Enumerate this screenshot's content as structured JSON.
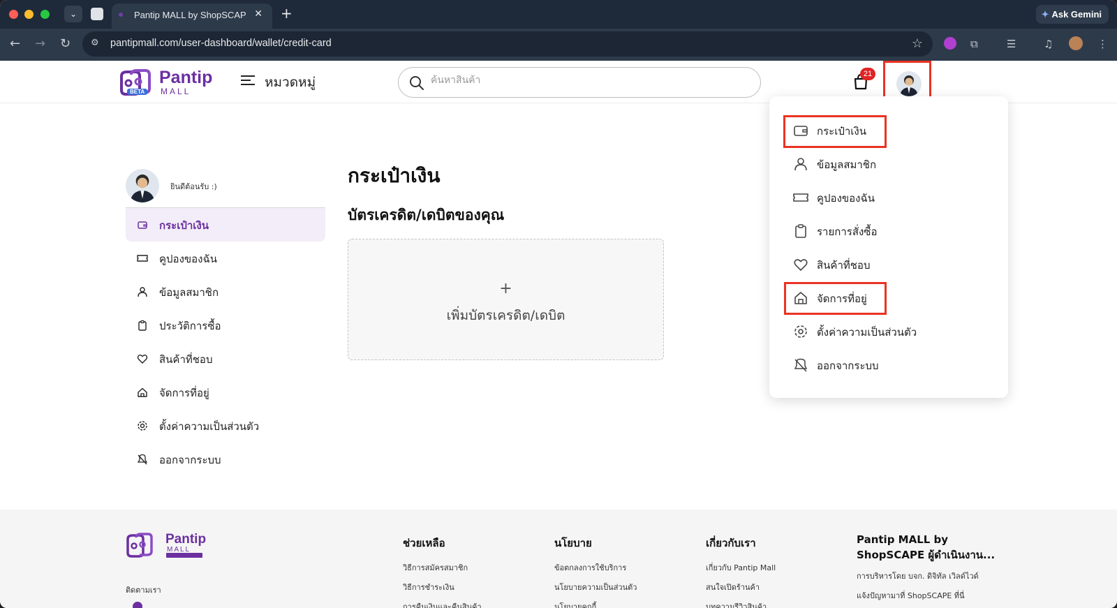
{
  "browser": {
    "tab_title": "Pantip MALL by ShopSCAPE",
    "new_tab": "+",
    "close": "✕",
    "ask_gemini": "Ask Gemini",
    "url": "pantipmall.com/user-dashboard/wallet/credit-card"
  },
  "header": {
    "logo_text": "Pantip",
    "logo_sub": "MALL",
    "beta": "BETA",
    "category_label": "หมวดหมู่",
    "search_placeholder": "ค้นหาสินค้า",
    "cart_count": "21"
  },
  "sidebar": {
    "welcome": "ยินดีต้อนรับ :)",
    "items": [
      {
        "label": "กระเป๋าเงิน"
      },
      {
        "label": "คูปองของฉัน"
      },
      {
        "label": "ข้อมูลสมาชิก"
      },
      {
        "label": "ประวัติการซื้อ"
      },
      {
        "label": "สินค้าที่ชอบ"
      },
      {
        "label": "จัดการที่อยู่"
      },
      {
        "label": "ตั้งค่าความเป็นส่วนตัว"
      },
      {
        "label": "ออกจากระบบ"
      }
    ]
  },
  "main": {
    "title": "กระเป๋าเงิน",
    "subtitle": "บัตรเครดิต/เดบิตของคุณ",
    "add_plus": "+",
    "add_card_label": "เพิ่มบัตรเครดิต/เดบิต"
  },
  "dropdown": {
    "items": [
      {
        "label": "กระเป๋าเงิน"
      },
      {
        "label": "ข้อมูลสมาชิก"
      },
      {
        "label": "คูปองของฉัน"
      },
      {
        "label": "รายการสั่งซื้อ"
      },
      {
        "label": "สินค้าที่ชอบ"
      },
      {
        "label": "จัดการที่อยู่"
      },
      {
        "label": "ตั้งค่าความเป็นส่วนตัว"
      },
      {
        "label": "ออกจากระบบ"
      }
    ]
  },
  "footer": {
    "follow_us": "ติดตามเรา",
    "help": {
      "title": "ช่วยเหลือ",
      "links": [
        "วิธีการสมัครสมาชิก",
        "วิธีการชำระเงิน",
        "การคืนเงินและคืนสินค้า"
      ]
    },
    "policy": {
      "title": "นโยบาย",
      "links": [
        "ข้อตกลงการใช้บริการ",
        "นโยบายความเป็นส่วนตัว",
        "นโยบายคุกกี้"
      ]
    },
    "about": {
      "title": "เกี่ยวกับเรา",
      "links": [
        "เกี่ยวกับ Pantip Mall",
        "สนใจเปิดร้านค้า",
        "บทความรีวิวสินค้า"
      ]
    },
    "operator": {
      "title": "Pantip MALL by ShopSCAPE ผู้ดำเนินงาน...",
      "links": [
        "การบริหารโดย บจก. ดิจิทัล เวิลด์ไวด์",
        "แจ้งปัญหามาที่ ShopSCAPE ที่นี่"
      ]
    }
  },
  "colors": {
    "brand": "#6b2fa0",
    "highlight": "#ea3323",
    "badge": "#e02424"
  }
}
